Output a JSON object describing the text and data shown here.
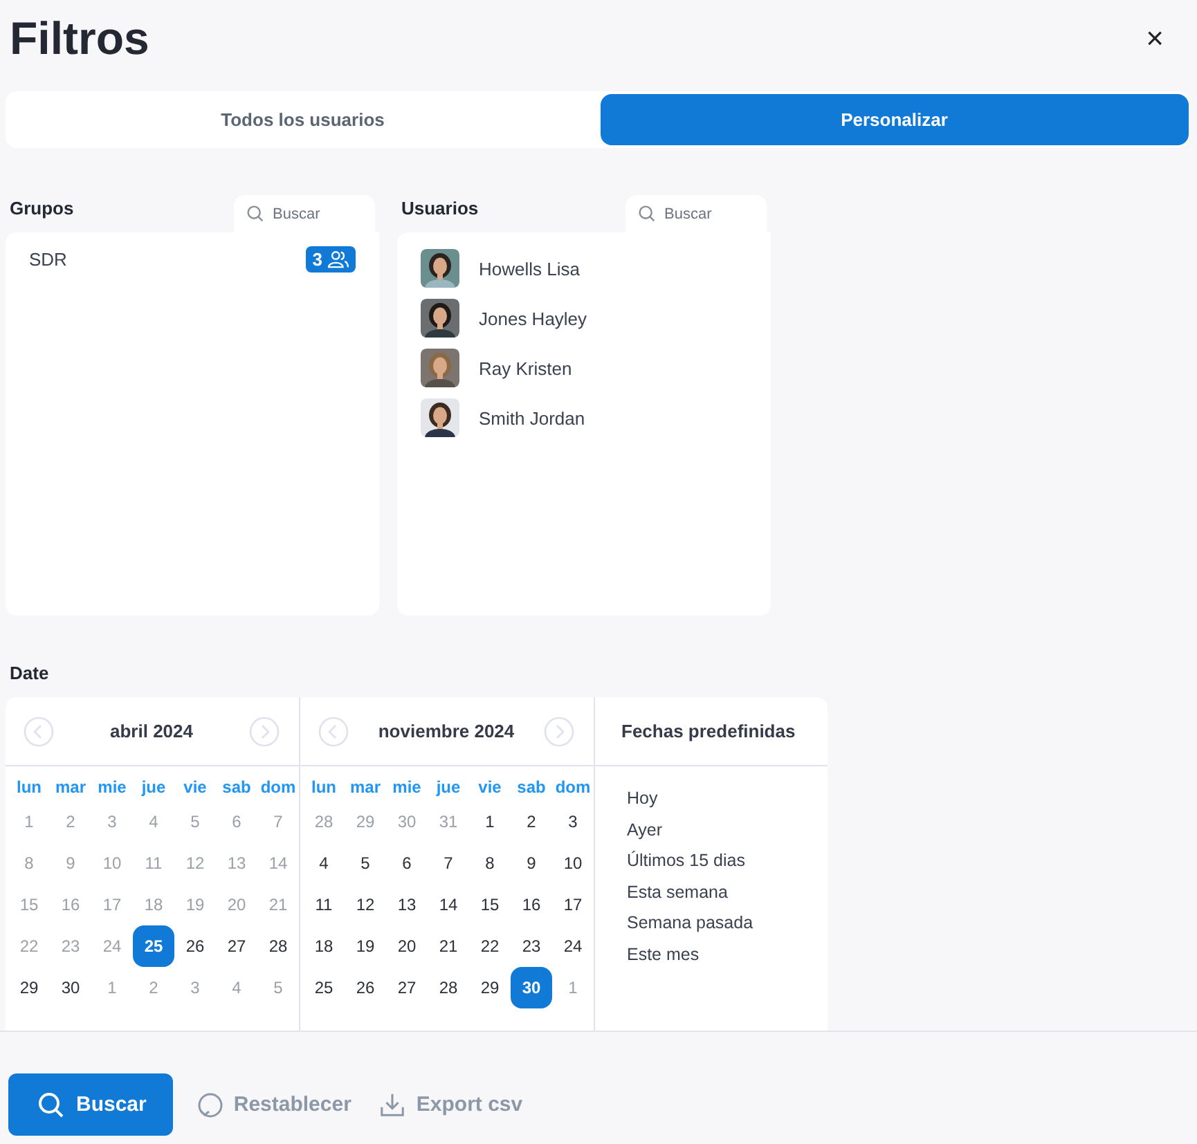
{
  "title": "Filtros",
  "close": "×",
  "tabs": [
    {
      "label": "Todos los usuarios",
      "selected": false
    },
    {
      "label": "Personalizar",
      "selected": true
    }
  ],
  "groups": {
    "heading": "Grupos",
    "search": {
      "placeholder": "Buscar"
    },
    "items": [
      {
        "name": "SDR",
        "count": "3"
      }
    ]
  },
  "users": {
    "heading": "Usuarios",
    "search": {
      "placeholder": "Buscar"
    },
    "items": [
      {
        "name": "Howells Lisa"
      },
      {
        "name": "Jones Hayley"
      },
      {
        "name": "Ray Kristen"
      },
      {
        "name": "Smith Jordan"
      }
    ]
  },
  "date": {
    "heading": "Date",
    "months": [
      {
        "title": "abril 2024",
        "weekdays": [
          "lun",
          "mar",
          "mie",
          "jue",
          "vie",
          "sab",
          "dom"
        ],
        "weeks": [
          [
            {
              "d": "1",
              "muted": true,
              "selected": false
            },
            {
              "d": "2",
              "muted": true,
              "selected": false
            },
            {
              "d": "3",
              "muted": true,
              "selected": false
            },
            {
              "d": "4",
              "muted": true,
              "selected": false
            },
            {
              "d": "5",
              "muted": true,
              "selected": false
            },
            {
              "d": "6",
              "muted": true,
              "selected": false
            },
            {
              "d": "7",
              "muted": true,
              "selected": false
            }
          ],
          [
            {
              "d": "8",
              "muted": true,
              "selected": false
            },
            {
              "d": "9",
              "muted": true,
              "selected": false
            },
            {
              "d": "10",
              "muted": true,
              "selected": false
            },
            {
              "d": "11",
              "muted": true,
              "selected": false
            },
            {
              "d": "12",
              "muted": true,
              "selected": false
            },
            {
              "d": "13",
              "muted": true,
              "selected": false
            },
            {
              "d": "14",
              "muted": true,
              "selected": false
            }
          ],
          [
            {
              "d": "15",
              "muted": true,
              "selected": false
            },
            {
              "d": "16",
              "muted": true,
              "selected": false
            },
            {
              "d": "17",
              "muted": true,
              "selected": false
            },
            {
              "d": "18",
              "muted": true,
              "selected": false
            },
            {
              "d": "19",
              "muted": true,
              "selected": false
            },
            {
              "d": "20",
              "muted": true,
              "selected": false
            },
            {
              "d": "21",
              "muted": true,
              "selected": false
            }
          ],
          [
            {
              "d": "22",
              "muted": true,
              "selected": false
            },
            {
              "d": "23",
              "muted": true,
              "selected": false
            },
            {
              "d": "24",
              "muted": true,
              "selected": false
            },
            {
              "d": "25",
              "muted": false,
              "selected": true
            },
            {
              "d": "26",
              "muted": false,
              "selected": false
            },
            {
              "d": "27",
              "muted": false,
              "selected": false
            },
            {
              "d": "28",
              "muted": false,
              "selected": false
            }
          ],
          [
            {
              "d": "29",
              "muted": false,
              "selected": false
            },
            {
              "d": "30",
              "muted": false,
              "selected": false
            },
            {
              "d": "1",
              "muted": true,
              "selected": false
            },
            {
              "d": "2",
              "muted": true,
              "selected": false
            },
            {
              "d": "3",
              "muted": true,
              "selected": false
            },
            {
              "d": "4",
              "muted": true,
              "selected": false
            },
            {
              "d": "5",
              "muted": true,
              "selected": false
            }
          ]
        ]
      },
      {
        "title": "noviembre 2024",
        "weekdays": [
          "lun",
          "mar",
          "mie",
          "jue",
          "vie",
          "sab",
          "dom"
        ],
        "weeks": [
          [
            {
              "d": "28",
              "muted": true,
              "selected": false
            },
            {
              "d": "29",
              "muted": true,
              "selected": false
            },
            {
              "d": "30",
              "muted": true,
              "selected": false
            },
            {
              "d": "31",
              "muted": true,
              "selected": false
            },
            {
              "d": "1",
              "muted": false,
              "selected": false
            },
            {
              "d": "2",
              "muted": false,
              "selected": false
            },
            {
              "d": "3",
              "muted": false,
              "selected": false
            }
          ],
          [
            {
              "d": "4",
              "muted": false,
              "selected": false
            },
            {
              "d": "5",
              "muted": false,
              "selected": false
            },
            {
              "d": "6",
              "muted": false,
              "selected": false
            },
            {
              "d": "7",
              "muted": false,
              "selected": false
            },
            {
              "d": "8",
              "muted": false,
              "selected": false
            },
            {
              "d": "9",
              "muted": false,
              "selected": false
            },
            {
              "d": "10",
              "muted": false,
              "selected": false
            }
          ],
          [
            {
              "d": "11",
              "muted": false,
              "selected": false
            },
            {
              "d": "12",
              "muted": false,
              "selected": false
            },
            {
              "d": "13",
              "muted": false,
              "selected": false
            },
            {
              "d": "14",
              "muted": false,
              "selected": false
            },
            {
              "d": "15",
              "muted": false,
              "selected": false
            },
            {
              "d": "16",
              "muted": false,
              "selected": false
            },
            {
              "d": "17",
              "muted": false,
              "selected": false
            }
          ],
          [
            {
              "d": "18",
              "muted": false,
              "selected": false
            },
            {
              "d": "19",
              "muted": false,
              "selected": false
            },
            {
              "d": "20",
              "muted": false,
              "selected": false
            },
            {
              "d": "21",
              "muted": false,
              "selected": false
            },
            {
              "d": "22",
              "muted": false,
              "selected": false
            },
            {
              "d": "23",
              "muted": false,
              "selected": false
            },
            {
              "d": "24",
              "muted": false,
              "selected": false
            }
          ],
          [
            {
              "d": "25",
              "muted": false,
              "selected": false
            },
            {
              "d": "26",
              "muted": false,
              "selected": false
            },
            {
              "d": "27",
              "muted": false,
              "selected": false
            },
            {
              "d": "28",
              "muted": false,
              "selected": false
            },
            {
              "d": "29",
              "muted": false,
              "selected": false
            },
            {
              "d": "30",
              "muted": false,
              "selected": true
            },
            {
              "d": "1",
              "muted": true,
              "selected": false
            }
          ]
        ]
      }
    ],
    "presets": {
      "heading": "Fechas predefinidas",
      "items": [
        "Hoy",
        "Ayer",
        "Últimos 15 dias",
        "Esta semana",
        "Semana pasada",
        "Este mes"
      ]
    }
  },
  "actions": [
    {
      "kind": "primary",
      "label": "Buscar"
    },
    {
      "kind": "reset",
      "label": "Restablecer"
    },
    {
      "kind": "export",
      "label": "Export csv"
    }
  ]
}
